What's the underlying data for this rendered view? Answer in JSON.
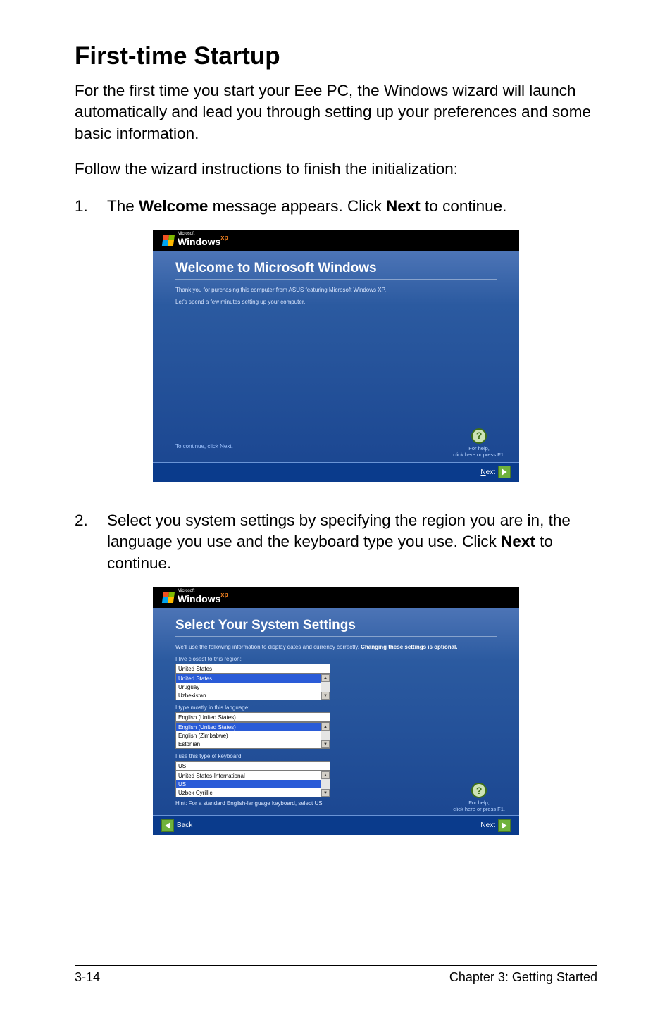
{
  "heading": "First-time Startup",
  "intro": "For the first time you start your Eee PC, the Windows wizard will launch automatically and lead you through setting up your preferences and some basic information.",
  "follow": "Follow the wizard instructions to finish the initialization:",
  "step1": {
    "num": "1.",
    "pre": "The ",
    "welcome": "Welcome",
    "mid": " message appears. Click ",
    "next": "Next",
    "post": " to continue."
  },
  "step2": {
    "num": "2.",
    "pre": "Select you system settings by specifying the region you are in, the language you use and the keyboard type you use. Click ",
    "next": "Next",
    "post": " to continue."
  },
  "logo": {
    "ms": "Microsoft",
    "windows": "Windows",
    "xp": "xp"
  },
  "shot1": {
    "title": "Welcome to Microsoft Windows",
    "line1": "Thank you for purchasing this computer from ASUS featuring Microsoft Windows XP.",
    "line2": "Let's spend a few minutes setting up your computer.",
    "continue": "To continue, click Next.",
    "help1": "For help,",
    "help2": "click here or press F1.",
    "next_u": "N",
    "next_rest": "ext"
  },
  "shot2": {
    "title": "Select Your System Settings",
    "line1_pre": "We'll use the following information to display dates and currency correctly. ",
    "line1_opt": "Changing these settings is optional.",
    "region_label": "I live closest to this region:",
    "region_sel": "United States",
    "region_opts": [
      "United States",
      "Uruguay",
      "Uzbekistan"
    ],
    "lang_label": "I type mostly in this language:",
    "lang_sel": "English (United States)",
    "lang_opts": [
      "English (United States)",
      "English (Zimbabwe)",
      "Estonian"
    ],
    "kb_label": "I use this type of keyboard:",
    "kb_sel": "US",
    "kb_opts": [
      "United States-International",
      "US",
      "Uzbek Cyrillic"
    ],
    "hint": "Hint: For a standard English-language keyboard, select US.",
    "help1": "For help,",
    "help2": "click here or press F1.",
    "back_u": "B",
    "back_rest": "ack",
    "next_u": "N",
    "next_rest": "ext"
  },
  "footer": {
    "left": "3-14",
    "right": "Chapter 3: Getting Started"
  }
}
